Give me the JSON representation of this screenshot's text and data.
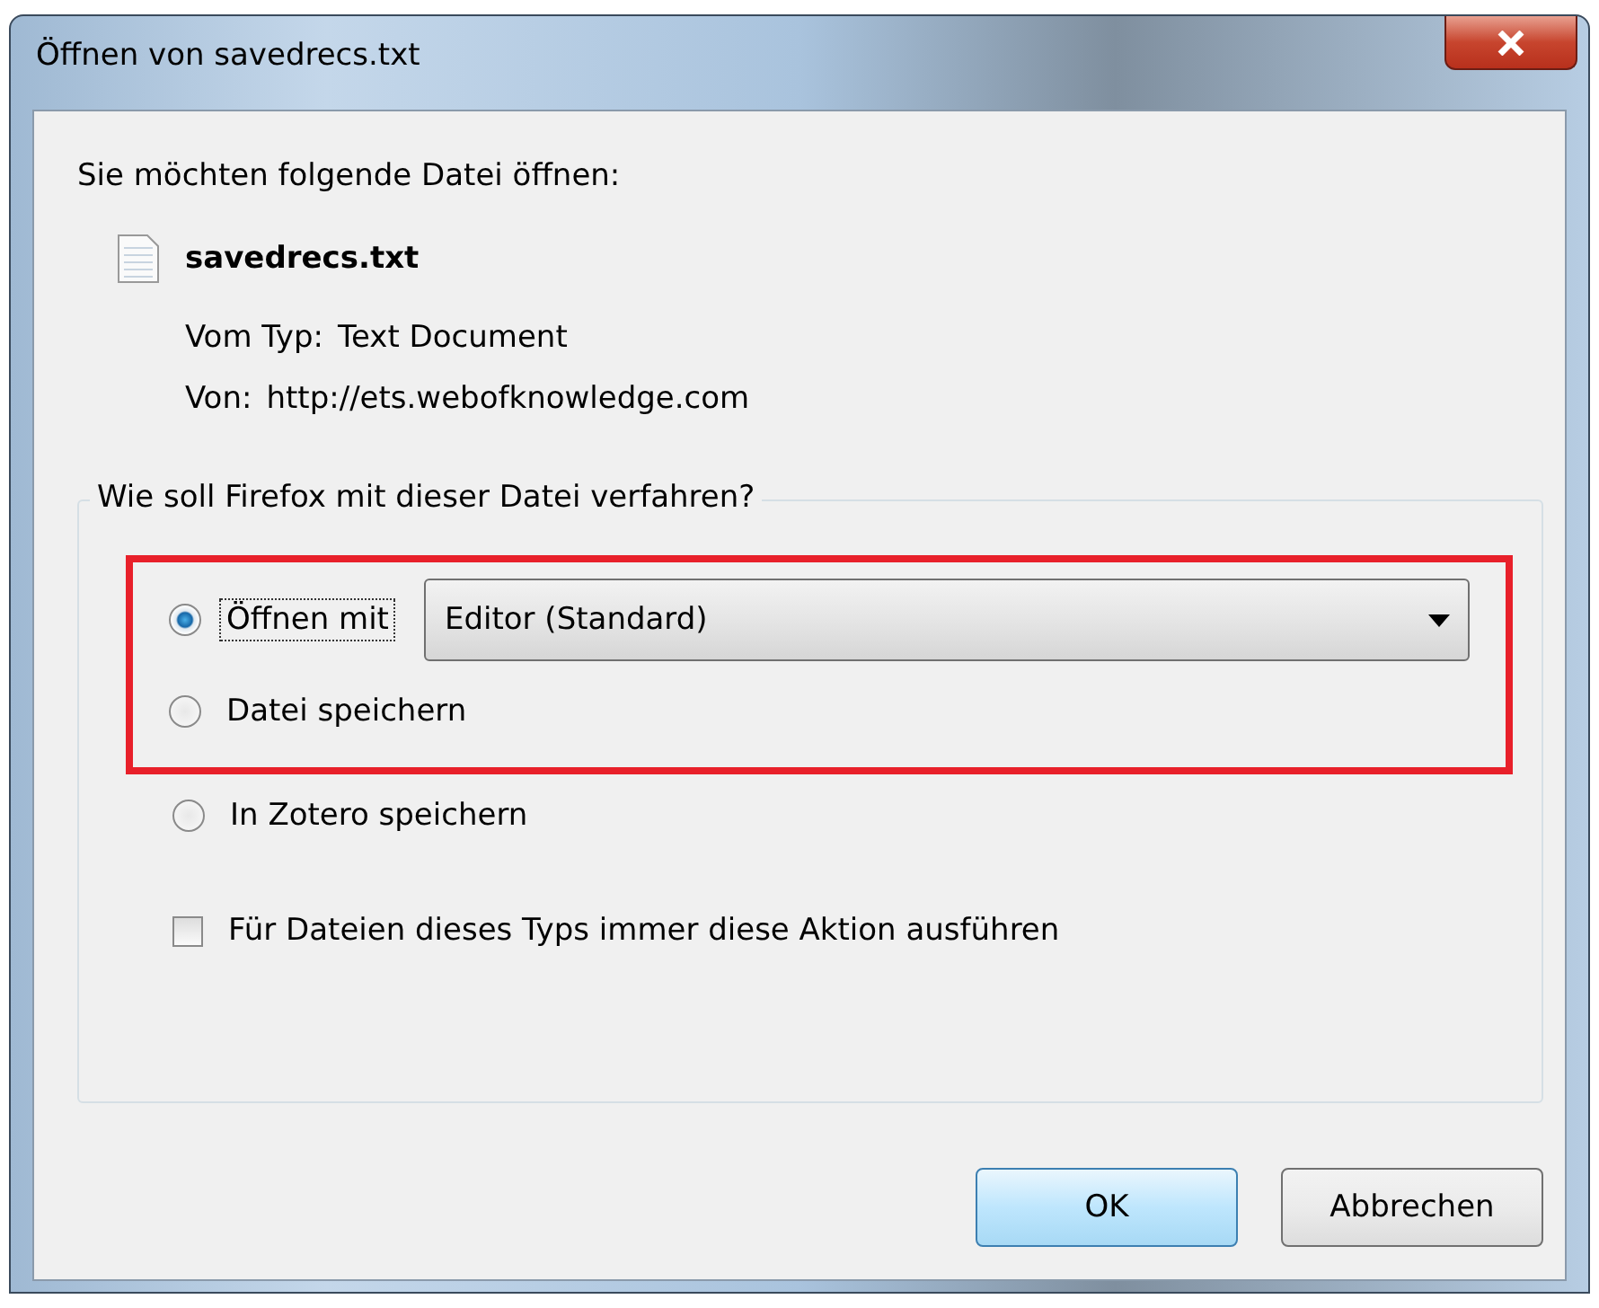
{
  "window": {
    "title": "Öffnen von savedrecs.txt"
  },
  "prompt": "Sie möchten folgende Datei öffnen:",
  "file": {
    "name": "savedrecs.txt",
    "type_label": "Vom Typ:",
    "type": "Text Document",
    "from_label": "Von:",
    "from": "http://ets.webofknowledge.com"
  },
  "group": {
    "legend": "Wie soll Firefox mit dieser Datei verfahren?",
    "options": [
      {
        "label": "Öffnen mit",
        "selected": true,
        "focused": true,
        "highlighted": true,
        "dropdown": {
          "value": "Editor (Standard)"
        }
      },
      {
        "label": "Datei speichern",
        "selected": false,
        "focused": false,
        "highlighted": true
      },
      {
        "label": "In Zotero speichern",
        "selected": false,
        "focused": false,
        "highlighted": false
      }
    ],
    "checkbox": {
      "label": "Für Dateien dieses Typs immer diese Aktion ausführen",
      "checked": false
    }
  },
  "buttons": [
    {
      "label": "OK",
      "default": true
    },
    {
      "label": "Abbrechen",
      "default": false
    }
  ]
}
